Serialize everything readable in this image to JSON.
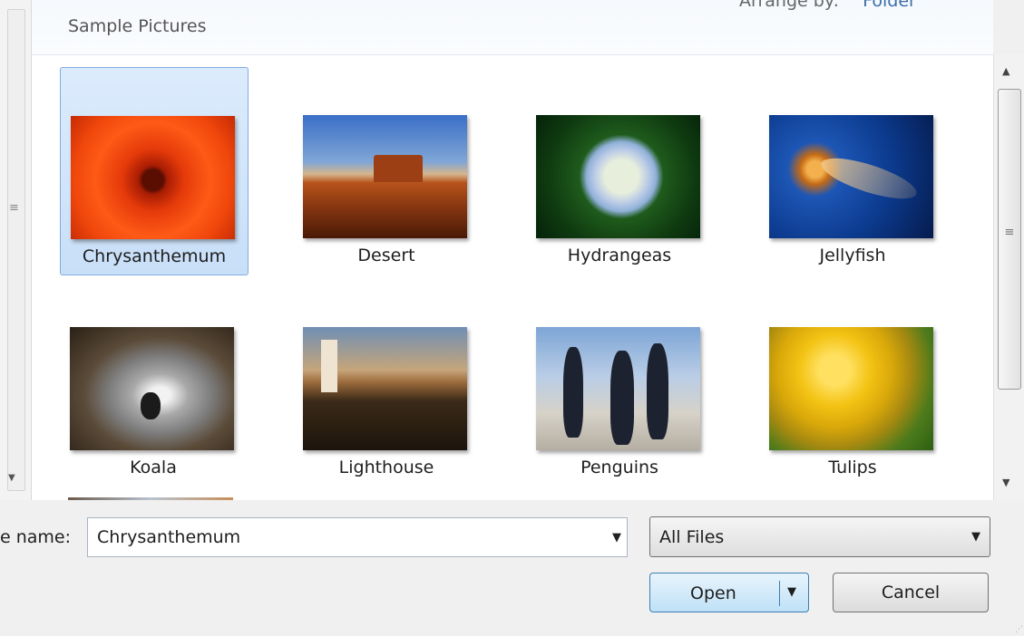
{
  "header": {
    "library_title": "Sample Pictures",
    "arrange_label": "Arrange by:",
    "arrange_value": "Folder"
  },
  "files": [
    {
      "name": "Chrysanthemum",
      "selected": true,
      "image": "chrysanthemum-photo"
    },
    {
      "name": "Desert",
      "selected": false,
      "image": "desert-photo"
    },
    {
      "name": "Hydrangeas",
      "selected": false,
      "image": "hydrangeas-photo"
    },
    {
      "name": "Jellyfish",
      "selected": false,
      "image": "jellyfish-photo"
    },
    {
      "name": "Koala",
      "selected": false,
      "image": "koala-photo"
    },
    {
      "name": "Lighthouse",
      "selected": false,
      "image": "lighthouse-photo"
    },
    {
      "name": "Penguins",
      "selected": false,
      "image": "penguins-photo"
    },
    {
      "name": "Tulips",
      "selected": false,
      "image": "tulips-photo"
    }
  ],
  "footer": {
    "file_name_label": "e name:",
    "file_name_value": "Chrysanthemum",
    "file_type_value": "All Files",
    "open_label": "Open",
    "cancel_label": "Cancel"
  },
  "icons": {
    "scroll_up": "scroll-up-arrow-icon",
    "scroll_down": "scroll-down-arrow-icon",
    "dropdown": "chevron-down-icon"
  },
  "colors": {
    "selection_fill": "#c8dff8",
    "selection_border": "#84acdd",
    "default_button_border": "#3c7fb1"
  }
}
